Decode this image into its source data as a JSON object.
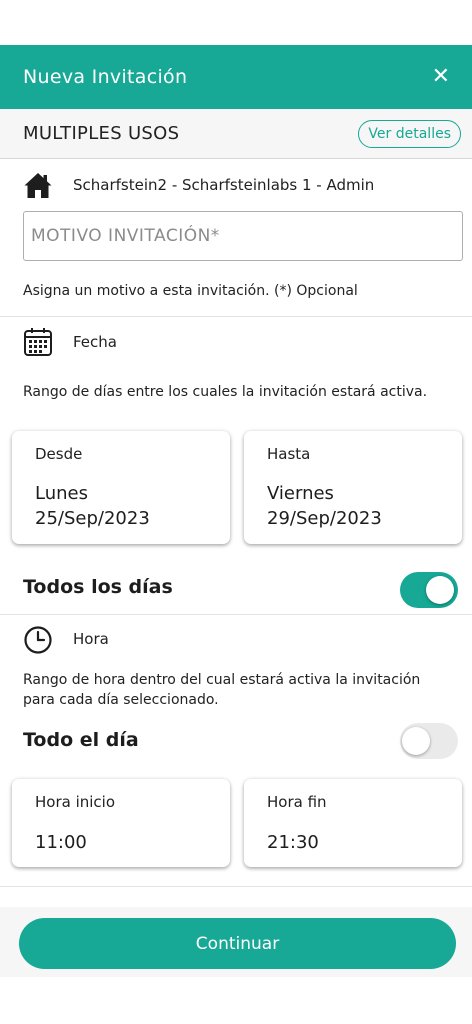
{
  "header": {
    "title": "Nueva Invitación",
    "close_icon": "close-icon"
  },
  "section": {
    "title": "MULTIPLES USOS",
    "details_label": "Ver detalles"
  },
  "location": {
    "icon": "home-icon",
    "text": "Scharfstein2 - Scharfsteinlabs 1 - Admin"
  },
  "motivo": {
    "placeholder": "MOTIVO INVITACIÓN*",
    "hint": "Asigna un motivo a esta invitación. (*) Opcional"
  },
  "fecha": {
    "icon": "calendar-icon",
    "label": "Fecha",
    "description": "Rango de días entre los cuales la invitación estará activa.",
    "desde": {
      "label": "Desde",
      "day": "Lunes",
      "date": "25/Sep/2023"
    },
    "hasta": {
      "label": "Hasta",
      "day": "Viernes",
      "date": "29/Sep/2023"
    }
  },
  "todos_los_dias": {
    "label": "Todos los días",
    "enabled": true
  },
  "hora": {
    "icon": "clock-icon",
    "label": "Hora",
    "description_line1": "Rango de hora dentro del cual estará activa la invitación",
    "description_line2": "para cada día seleccionado.",
    "inicio": {
      "label": "Hora inicio",
      "value": "11:00"
    },
    "fin": {
      "label": "Hora fin",
      "value": "21:30"
    }
  },
  "todo_el_dia": {
    "label": "Todo el día",
    "enabled": false
  },
  "footer": {
    "continue_label": "Continuar"
  },
  "colors": {
    "accent": "#17a896",
    "text": "#1d1d1d",
    "placeholder": "#8b8b8b"
  }
}
